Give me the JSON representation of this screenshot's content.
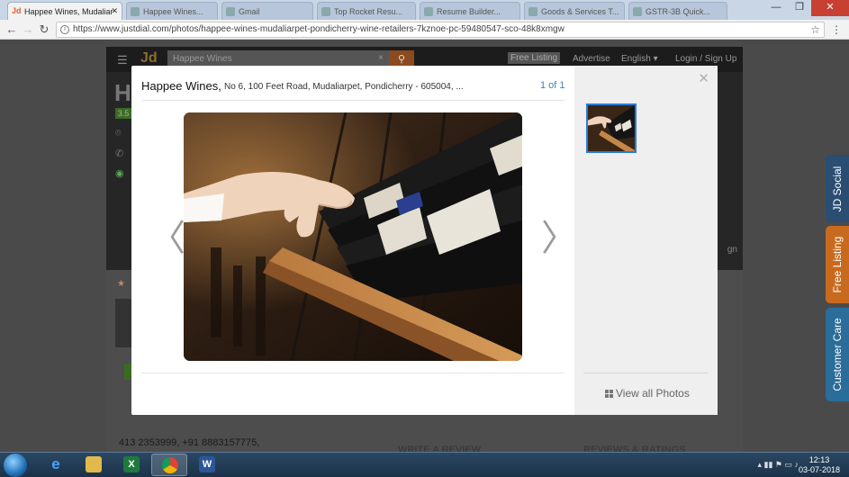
{
  "browser": {
    "tabs": [
      {
        "label": "Happee Wines, Mudaliar",
        "active": true
      },
      {
        "label": "Happee Wines...",
        "active": false
      },
      {
        "label": "Gmail",
        "active": false
      },
      {
        "label": "Top Rocket Resu...",
        "active": false
      },
      {
        "label": "Resume Builder...",
        "active": false
      },
      {
        "label": "Goods & Services T...",
        "active": false
      },
      {
        "label": "GSTR-3B Quick...",
        "active": false
      }
    ],
    "url": "https://www.justdial.com/photos/happee-wines-mudaliarpet-pondicherry-wine-retailers-7kznoe-pc-59480547-sco-48k8xmgw"
  },
  "site": {
    "logo": "Jd",
    "search_value": "Happee Wines",
    "free_listing": "Free Listing",
    "advertise": "Advertise",
    "language": "English",
    "login": "Login / Sign Up",
    "business_initial": "H",
    "rating": "3.5",
    "phone": "413 2353999, +91 8883157775,",
    "write_review": "WRITE A REVIEW",
    "reviews_ratings": "REVIEWS & RATINGS",
    "sign_partial": "gn"
  },
  "side_tabs": {
    "social": "JD Social",
    "free_listing": "Free Listing",
    "customer_care": "Customer Care"
  },
  "modal": {
    "title": "Happee Wines,",
    "address": "No 6, 100 Feet Road, Mudaliarpet, Pondicherry - 605004, ...",
    "counter": "1 of 1",
    "view_all": "View all Photos",
    "photo_subject": "hand-reaching-wine-bottles-on-shelf"
  },
  "taskbar": {
    "apps": [
      "explorer",
      "internet-explorer",
      "file-explorer",
      "excel",
      "chrome",
      "word"
    ],
    "time": "12:13",
    "date": "03-07-2018"
  },
  "colors": {
    "accent_blue": "#3a7fc1",
    "thumb_border": "#2d7ad6",
    "side_social": "#2a4d72",
    "side_free": "#c86a1e",
    "side_care": "#2a6c9a"
  }
}
